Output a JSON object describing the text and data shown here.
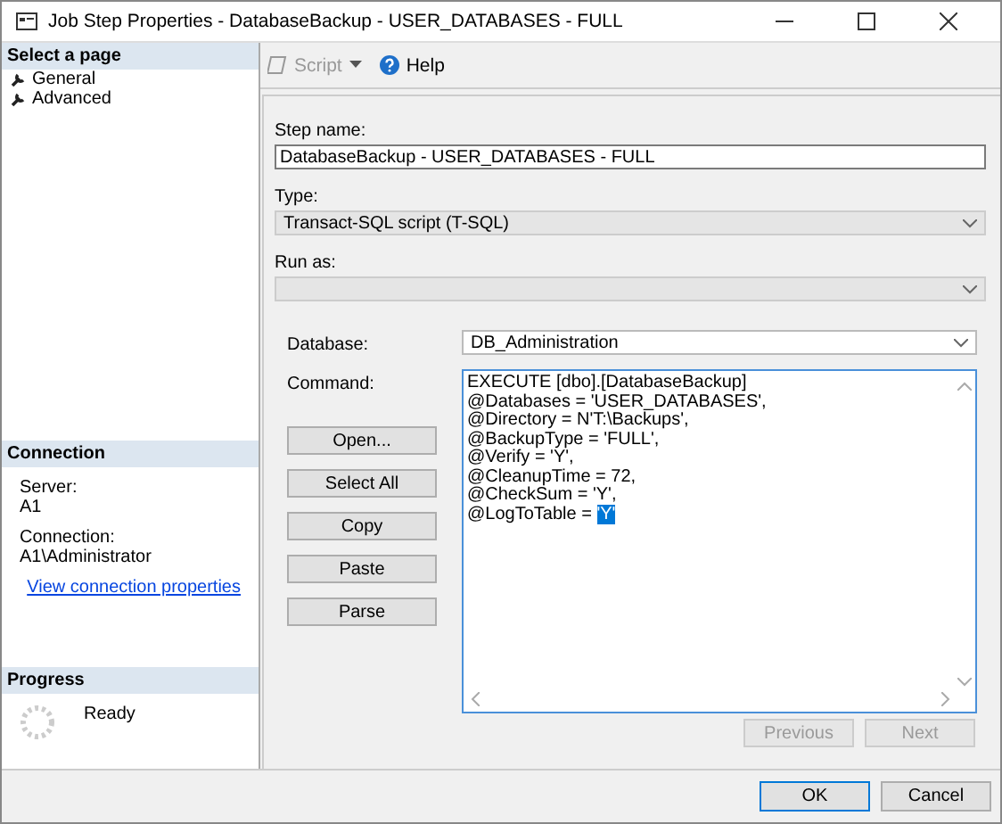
{
  "window": {
    "title": "Job Step Properties - DatabaseBackup - USER_DATABASES - FULL"
  },
  "sidebar": {
    "header": "Select a page",
    "pages": [
      {
        "label": "General"
      },
      {
        "label": "Advanced"
      }
    ],
    "connection": {
      "header": "Connection",
      "server_label": "Server:",
      "server": "A1",
      "connection_label": "Connection:",
      "connection": "A1\\Administrator",
      "link": "View connection properties"
    },
    "progress": {
      "header": "Progress",
      "status": "Ready"
    }
  },
  "toolbar": {
    "script": {
      "label": "Script",
      "disabled": true
    },
    "help": "Help"
  },
  "form": {
    "step_name_label": "Step name:",
    "step_name": "DatabaseBackup - USER_DATABASES - FULL",
    "type_label": "Type:",
    "type": "Transact-SQL script (T-SQL)",
    "run_as_label": "Run as:",
    "database_label": "Database:",
    "database": "DB_Administration",
    "command_label": "Command:",
    "command_lines": [
      {
        "text": "EXECUTE [dbo].[DatabaseBackup]"
      },
      {
        "text": "@Databases = 'USER_DATABASES',"
      },
      {
        "text": "@Directory = N'T:\\Backups',"
      },
      {
        "text": "@BackupType = 'FULL',"
      },
      {
        "text": "@Verify = 'Y',"
      },
      {
        "text": "@CleanupTime = 72,"
      },
      {
        "text": "@CheckSum = 'Y',"
      },
      {
        "text": "@LogToTable = ",
        "highlight": "'Y'"
      }
    ],
    "side_buttons": [
      "Open...",
      "Select All",
      "Copy",
      "Paste",
      "Parse"
    ],
    "nav_buttons": [
      {
        "label": "Previous",
        "disabled": true
      },
      {
        "label": "Next",
        "disabled": true
      }
    ]
  },
  "footer_buttons": [
    {
      "label": "OK",
      "default": true
    },
    {
      "label": "Cancel",
      "default": false
    }
  ]
}
